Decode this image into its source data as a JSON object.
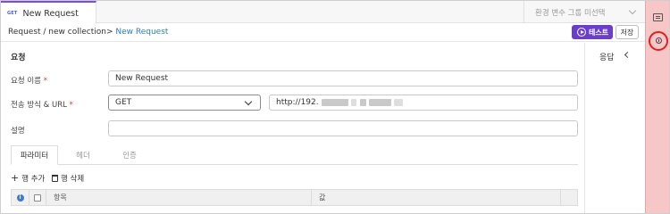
{
  "tab": {
    "method_badge": "GET",
    "title": "New Request"
  },
  "env_select": {
    "placeholder": "환경 변수 그룹 미선택"
  },
  "breadcrumb": {
    "path": "Request / new collection> ",
    "current": "New Request"
  },
  "toolbar": {
    "test_label": "테스트",
    "save_label": "저장"
  },
  "form": {
    "section_title": "요청",
    "name_label": "요청 이름",
    "name_value": "New Request",
    "method_url_label": "전송 방식 & URL",
    "method_value": "GET",
    "url_value": "http://192.",
    "description_label": "설명",
    "description_value": "",
    "required_mark": "*"
  },
  "subtabs": [
    "파라미터",
    "헤더",
    "인증"
  ],
  "params": {
    "add_row_label": "행 추가",
    "delete_row_label": "행 삭제",
    "columns": {
      "info": "i",
      "item": "항목",
      "value": "값"
    }
  },
  "response": {
    "title": "응답"
  },
  "colors": {
    "accent": "#6a3ec9",
    "link": "#2d7bc4",
    "sidebar_bg": "#f7c6c6",
    "highlight_ring": "#e02020"
  },
  "icons": [
    "list-icon",
    "history-icon",
    "chevron-down-icon",
    "chevron-left-icon",
    "play-icon",
    "plus-icon",
    "trash-icon",
    "info-icon"
  ]
}
